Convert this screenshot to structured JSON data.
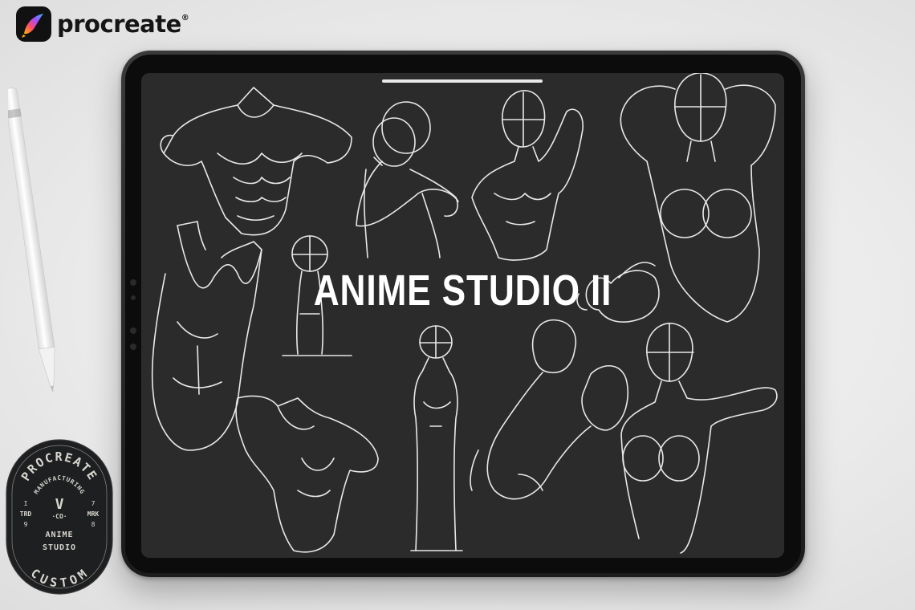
{
  "brand": {
    "name": "procreate",
    "registered_mark": "®",
    "icon": "procreate-logo-icon"
  },
  "screen": {
    "title": "ANIME STUDIO II"
  },
  "badge": {
    "top_arc": "PROCREATE",
    "mid_arc": "MANUFACTURING",
    "center_letter": "V",
    "center_sub": "·CO·",
    "left_col": [
      "I",
      "TRD",
      "9"
    ],
    "right_col": [
      "7",
      "MRK",
      "8"
    ],
    "line1": "ANIME",
    "line2": "STUDIO",
    "bottom_arc": "CUSTOM"
  },
  "colors": {
    "page_bg": "#ececec",
    "screen_bg": "#2b2b2b",
    "sketch_line": "#e8e8e8",
    "badge_bg": "#1e1f21",
    "badge_text": "#d8d6cf"
  }
}
